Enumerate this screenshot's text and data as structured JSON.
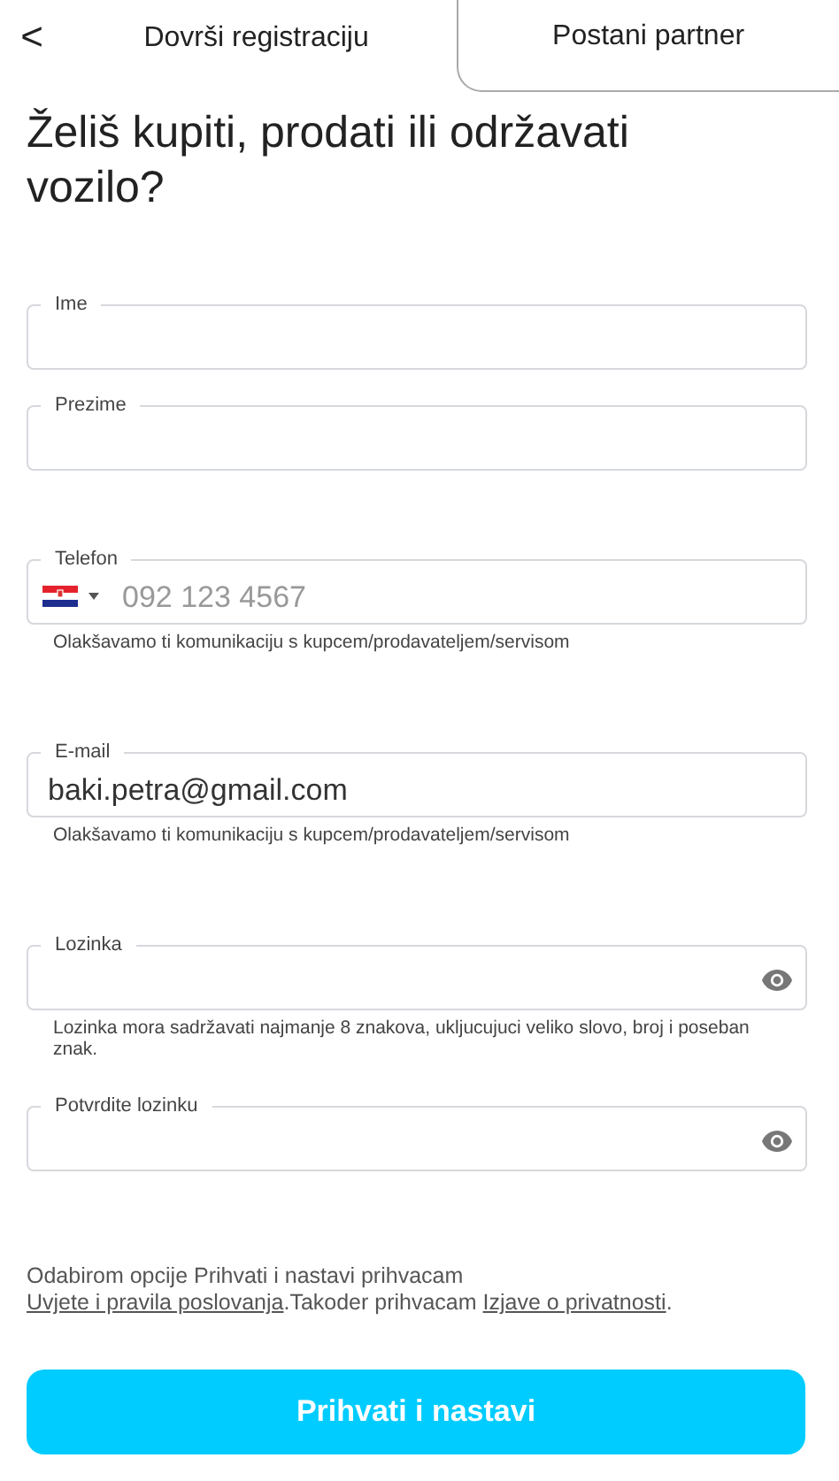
{
  "header": {
    "back": "<",
    "tabs": [
      {
        "label": "Dovrši registraciju",
        "selected": true
      },
      {
        "label": "Postani partner",
        "selected": false
      }
    ]
  },
  "title": "Želiš kupiti, prodati ili održavati vozilo?",
  "fields": [
    {
      "kind": "text",
      "label": "Ime"
    },
    {
      "kind": "text",
      "label": "Prezime"
    },
    {
      "kind": "phone",
      "label": "Telefon",
      "placeholder": "092 123 4567",
      "hint": "Olakšavamo ti komunikaciju s kupcem/prodavateljem/servisom"
    },
    {
      "kind": "text",
      "label": "E-mail",
      "value": "baki.petra@gmail.com",
      "hint": "Olakšavamo ti komunikaciju s kupcem/prodavateljem/servisom"
    },
    {
      "kind": "password",
      "label": "Lozinka",
      "hint": "Lozinka mora sadržavati najmanje 8 znakova, ukljucujuci veliko slovo, broj i poseban znak."
    },
    {
      "kind": "password",
      "label": "Potvrdite lozinku"
    }
  ],
  "terms": [
    {
      "kind": "text",
      "text": "Odabirom opcije Prihvati i nastavi prihvacam "
    },
    {
      "kind": "link",
      "text": "Uvjete i pravila poslovanja"
    },
    {
      "kind": "text",
      "text": ".Takoder prihvacam "
    },
    {
      "kind": "link",
      "text": "Izjave o privatnosti"
    },
    {
      "kind": "text",
      "text": "."
    }
  ],
  "button": "Prihvati i nastavi"
}
